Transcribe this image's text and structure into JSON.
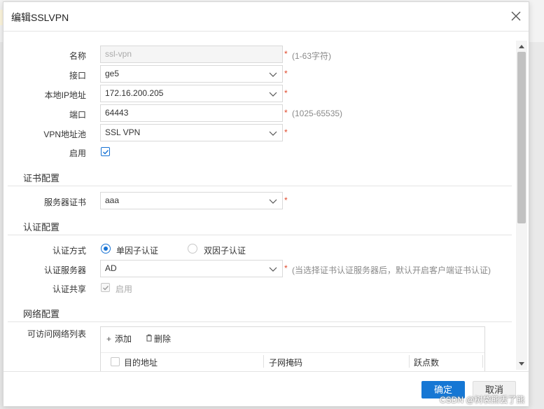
{
  "dialog": {
    "title": "编辑SSLVPN",
    "fields": {
      "name": {
        "label": "名称",
        "value": "ssl-vpn",
        "hint": "(1-63字符)"
      },
      "interface": {
        "label": "接口",
        "value": "ge5"
      },
      "local_ip": {
        "label": "本地IP地址",
        "value": "172.16.200.205"
      },
      "port": {
        "label": "端口",
        "value": "64443",
        "hint": "(1025-65535)"
      },
      "vpn_pool": {
        "label": "VPN地址池",
        "value": "SSL VPN"
      },
      "enable": {
        "label": "启用",
        "checked": true
      }
    },
    "required_mark": "*",
    "cert_section": {
      "title": "证书配置",
      "server_cert": {
        "label": "服务器证书",
        "value": "aaa"
      }
    },
    "auth_section": {
      "title": "认证配置",
      "auth_method": {
        "label": "认证方式",
        "option1": "单因子认证",
        "option2": "双因子认证",
        "selected": "单因子认证"
      },
      "auth_server": {
        "label": "认证服务器",
        "value": "AD",
        "hint": "(当选择证书认证服务器后，默认开启客户端证书认证)"
      },
      "auth_share": {
        "label": "认证共享",
        "checkbox_text": "启用",
        "checked": true
      }
    },
    "network_section": {
      "title": "网络配置",
      "list_label": "可访问网络列表",
      "add_label": "添加",
      "delete_label": "删除",
      "columns": [
        "目的地址",
        "子网掩码",
        "跃点数"
      ]
    },
    "footer": {
      "ok_label": "确定",
      "cancel_label": "取消"
    }
  },
  "watermark": "CSDN @树袋熊丢了熊",
  "colors": {
    "primary": "#1677d4",
    "required": "#e0492b",
    "hint": "#8a8a8a"
  }
}
